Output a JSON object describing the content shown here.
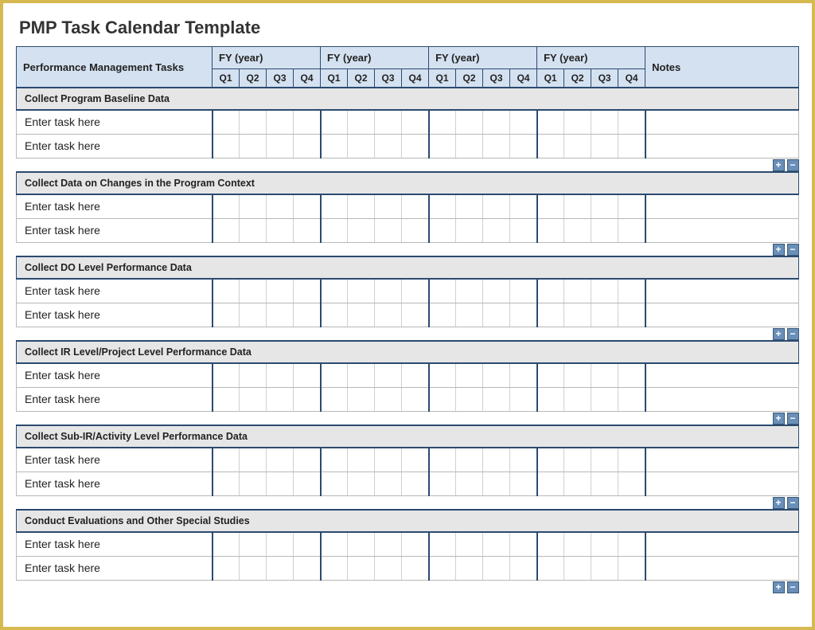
{
  "title": "PMP Task Calendar Template",
  "header": {
    "tasks_label": "Performance Management Tasks",
    "fy_label": "FY  (year)",
    "quarters": [
      "Q1",
      "Q2",
      "Q3",
      "Q4"
    ],
    "notes_label": "Notes"
  },
  "task_placeholder": "Enter task here",
  "controls": {
    "plus": "+",
    "minus": "−"
  },
  "sections": [
    {
      "title": "Collect Program Baseline Data"
    },
    {
      "title": "Collect Data on Changes in the Program Context"
    },
    {
      "title": "Collect DO Level Performance Data"
    },
    {
      "title": "Collect IR Level/Project Level Performance Data"
    },
    {
      "title": "Collect Sub-IR/Activity Level Performance Data"
    },
    {
      "title": "Conduct Evaluations and Other Special Studies"
    }
  ]
}
